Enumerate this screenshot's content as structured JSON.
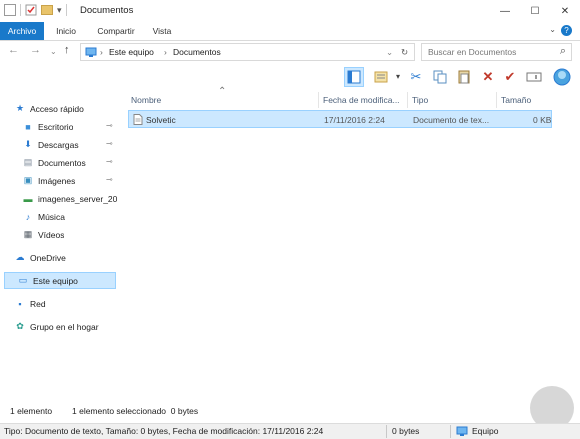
{
  "window": {
    "title": "Documentos"
  },
  "window_controls": {
    "minimize": "—",
    "maximize": "☐",
    "close": "✕"
  },
  "ribbon": {
    "tabs": [
      "Archivo",
      "Inicio",
      "Compartir",
      "Vista"
    ],
    "help_icon": "?",
    "collapse_icon": "⌄"
  },
  "navigation": {
    "back_icon": "←",
    "forward_icon": "→",
    "recent_icon": "⌄",
    "up_icon": "↑",
    "address": [
      "Este equipo",
      "Documentos"
    ],
    "address_separator": "›",
    "refresh_icon": "↻",
    "search_placeholder": "Buscar en Documentos",
    "search_icon": "⌕"
  },
  "nav_pane": {
    "items": [
      {
        "label": "Acceso rápido",
        "icon": "star-icon",
        "glyph": "★",
        "color": "#2b7bd1"
      },
      {
        "label": "Escritorio",
        "icon": "desktop-icon",
        "glyph": "■",
        "color": "#3b8fd9",
        "pinned": true
      },
      {
        "label": "Descargas",
        "icon": "download-icon",
        "glyph": "⬇",
        "color": "#2b7bd1",
        "pinned": true
      },
      {
        "label": "Documentos",
        "icon": "document-icon",
        "glyph": "▤",
        "color": "#7d8a99",
        "pinned": true
      },
      {
        "label": "Imágenes",
        "icon": "picture-icon",
        "glyph": "▣",
        "color": "#3a8fbf",
        "pinned": true
      },
      {
        "label": "imagenes_server_20",
        "icon": "server-folder-icon",
        "glyph": "▬",
        "color": "#3a9a4a"
      },
      {
        "label": "Música",
        "icon": "music-icon",
        "glyph": "♪",
        "color": "#2b7bd1"
      },
      {
        "label": "Vídeos",
        "icon": "video-icon",
        "glyph": "▦",
        "color": "#555d66"
      },
      {
        "label": "OneDrive",
        "icon": "cloud-icon",
        "glyph": "☁",
        "color": "#2b7bd1"
      },
      {
        "label": "Este equipo",
        "icon": "computer-icon",
        "glyph": "▭",
        "color": "#2b7bd1",
        "selected": true
      },
      {
        "label": "Red",
        "icon": "network-icon",
        "glyph": "▪",
        "color": "#2b7bd1"
      },
      {
        "label": "Grupo en el hogar",
        "icon": "homegroup-icon",
        "glyph": "✿",
        "color": "#2a9d8f"
      }
    ],
    "pin_glyph": "📌"
  },
  "columns": [
    "Nombre",
    "Fecha de modifica...",
    "Tipo",
    "Tamaño"
  ],
  "files": [
    {
      "name": "Solvetic",
      "date": "17/11/2016 2:24",
      "type": "Documento de tex...",
      "size": "0 KB"
    }
  ],
  "status": {
    "count": "1 elemento",
    "selection": "1 elemento seleccionado  0 bytes"
  },
  "details_bar": {
    "info": "Tipo: Documento de texto, Tamaño: 0 bytes, Fecha de modificación: 17/11/2016 2:24",
    "size": "0 bytes",
    "location": "Equipo"
  },
  "colors": {
    "accent": "#1979ca",
    "selection": "#cce8ff",
    "selection_border": "#99d1ff"
  }
}
